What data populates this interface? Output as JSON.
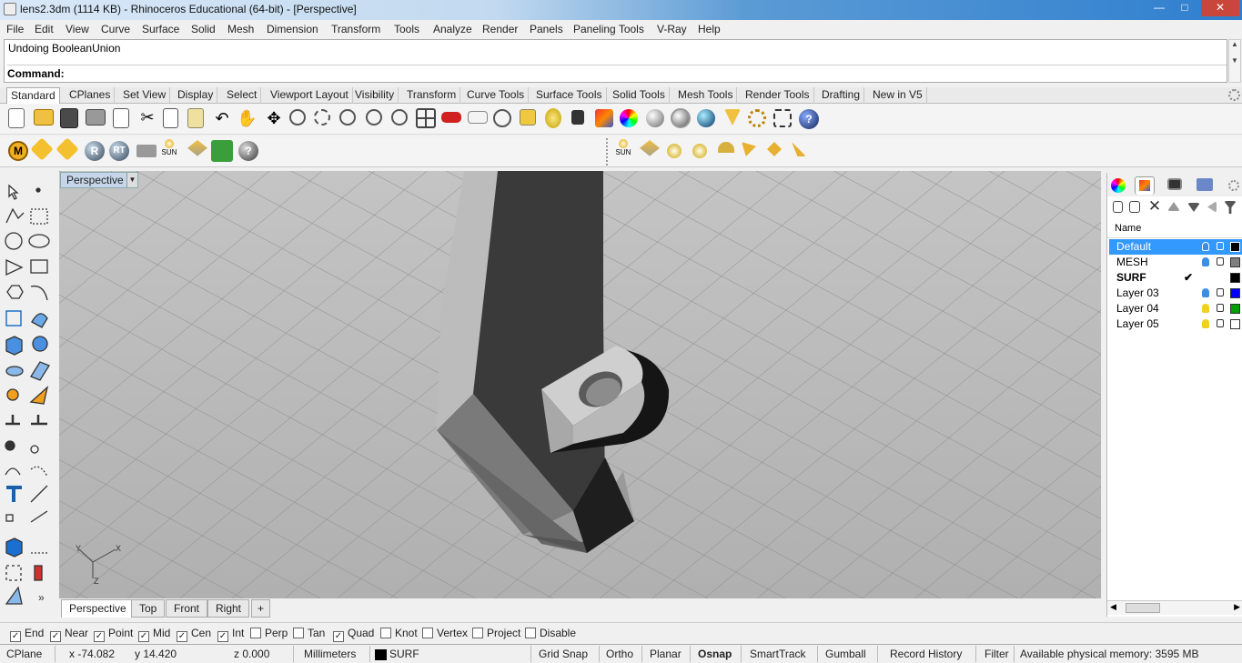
{
  "window": {
    "title": "lens2.3dm (1114 KB) - Rhinoceros Educational (64-bit) - [Perspective]"
  },
  "menu": [
    "File",
    "Edit",
    "View",
    "Curve",
    "Surface",
    "Solid",
    "Mesh",
    "Dimension",
    "Transform",
    "Tools",
    "Analyze",
    "Render",
    "Panels",
    "Paneling Tools",
    "V-Ray",
    "Help"
  ],
  "command": {
    "history": "Undoing BooleanUnion",
    "prompt": "Command:"
  },
  "toolbar_tabs": [
    "Standard",
    "CPlanes",
    "Set View",
    "Display",
    "Select",
    "Viewport Layout",
    "Visibility",
    "Transform",
    "Curve Tools",
    "Surface Tools",
    "Solid Tools",
    "Mesh Tools",
    "Render Tools",
    "Drafting",
    "New in V5"
  ],
  "toolbar2": {
    "sun_label_1": "SUN",
    "sun_label_2": "SUN",
    "r_label": "R",
    "rt_label": "RT",
    "m_label": "M"
  },
  "viewport": {
    "name": "Perspective",
    "axis_x": "X",
    "axis_y": "Y",
    "axis_z": "Z"
  },
  "viewport_tabs": [
    "Perspective",
    "Top",
    "Front",
    "Right"
  ],
  "layers": {
    "header": "Name",
    "items": [
      {
        "name": "Default",
        "color": "#000000",
        "bulb": "#3a8ee6",
        "selected": true
      },
      {
        "name": "MESH",
        "color": "#808080",
        "bulb": "#3a8ee6"
      },
      {
        "name": "SURF",
        "color": "#000000",
        "current": true,
        "check": "✔"
      },
      {
        "name": "Layer 03",
        "color": "#0000ff",
        "bulb": "#3a8ee6"
      },
      {
        "name": "Layer 04",
        "color": "#00a000",
        "bulb": "#f0d020"
      },
      {
        "name": "Layer 05",
        "color": "#ffffff",
        "bulb": "#f0d020"
      }
    ]
  },
  "osnap": [
    {
      "label": "End",
      "checked": true
    },
    {
      "label": "Near",
      "checked": true
    },
    {
      "label": "Point",
      "checked": true
    },
    {
      "label": "Mid",
      "checked": true
    },
    {
      "label": "Cen",
      "checked": true
    },
    {
      "label": "Int",
      "checked": true
    },
    {
      "label": "Perp",
      "checked": false
    },
    {
      "label": "Tan",
      "checked": false
    },
    {
      "label": "Quad",
      "checked": true
    },
    {
      "label": "Knot",
      "checked": false
    },
    {
      "label": "Vertex",
      "checked": false
    },
    {
      "label": "Project",
      "checked": false
    },
    {
      "label": "Disable",
      "checked": false
    }
  ],
  "status": {
    "cplane": "CPlane",
    "x": "x -74.082",
    "y": "y 14.420",
    "z": "z 0.000",
    "units": "Millimeters",
    "layer": "SURF",
    "grid_snap": "Grid Snap",
    "ortho": "Ortho",
    "planar": "Planar",
    "osnap": "Osnap",
    "smarttrack": "SmartTrack",
    "gumball": "Gumball",
    "record_history": "Record History",
    "filter": "Filter",
    "memory": "Available physical memory: 3595 MB"
  }
}
